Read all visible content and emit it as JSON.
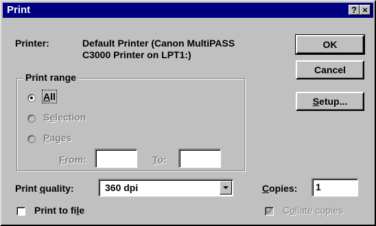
{
  "window": {
    "title": "Print",
    "help_button": "?",
    "close_button": "×"
  },
  "printer": {
    "label": "Printer:",
    "name_line1": "Default Printer (Canon MultiPASS",
    "name_line2": "C3000 Printer on LPT1:)"
  },
  "buttons": {
    "ok": "OK",
    "cancel": "Cancel",
    "setup_mnemonic": "S",
    "setup_rest": "etup..."
  },
  "print_range": {
    "title": "Print range",
    "all_mnemonic": "A",
    "all_rest": "ll",
    "selection_pre": "S",
    "selection_mnemonic": "e",
    "selection_rest": "lection",
    "pages_mnemonic": "P",
    "pages_rest": "ages",
    "from_mnemonic": "F",
    "from_rest": "rom:",
    "to_mnemonic": "T",
    "to_rest": "o:",
    "from_value": "",
    "to_value": "",
    "selected": "All"
  },
  "quality": {
    "label_pre": "Print ",
    "label_mnemonic": "q",
    "label_rest": "uality:",
    "value": "360 dpi"
  },
  "copies": {
    "label_mnemonic": "C",
    "label_rest": "opies:",
    "value": "1"
  },
  "print_to_file": {
    "label_pre": "Print to fi",
    "label_mnemonic": "l",
    "label_rest": "e",
    "checked": false
  },
  "collate": {
    "label_pre": "C",
    "label_mnemonic": "o",
    "label_rest": "llate copies",
    "checked": true,
    "enabled": false
  }
}
